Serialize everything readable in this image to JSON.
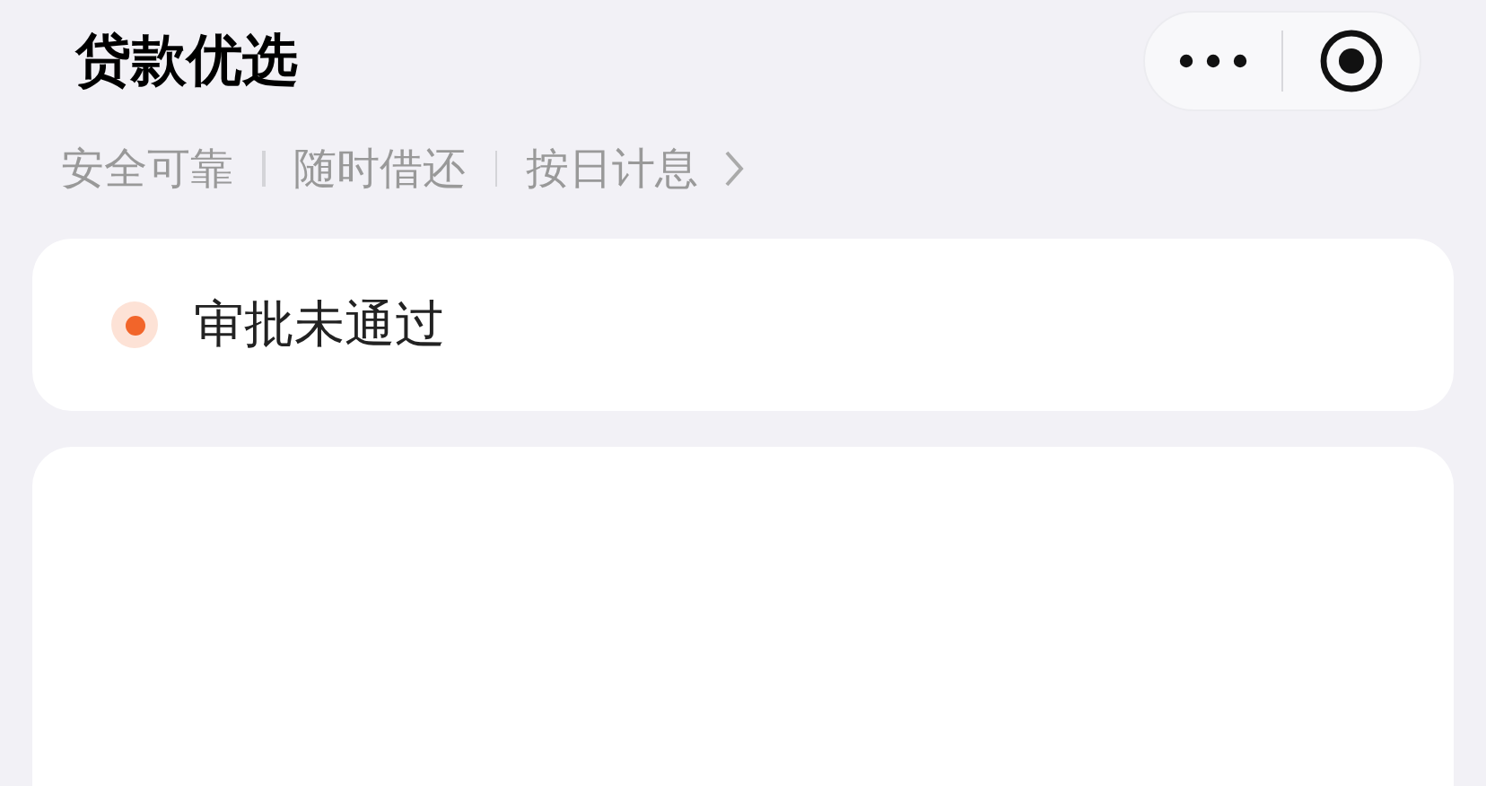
{
  "header": {
    "title": "贷款优选"
  },
  "taglines": [
    "安全可靠",
    "随时借还",
    "按日计息"
  ],
  "status_card": {
    "label": "审批未通过"
  }
}
